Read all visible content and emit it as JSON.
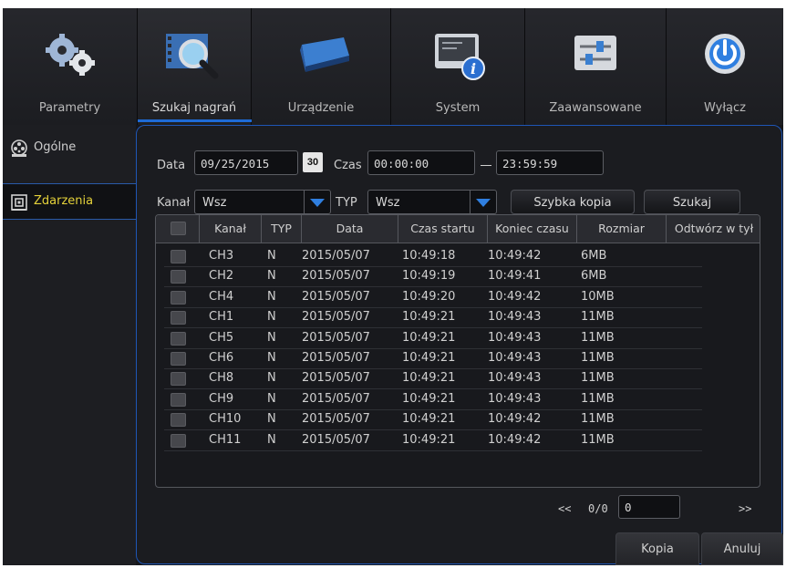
{
  "nav": {
    "items": [
      {
        "label": "Parametry"
      },
      {
        "label": "Szukaj nagrań"
      },
      {
        "label": "Urządzenie"
      },
      {
        "label": "System"
      },
      {
        "label": "Zaawansowane"
      },
      {
        "label": "Wyłącz"
      }
    ],
    "active_index": 1
  },
  "sidebar": {
    "items": [
      {
        "label": "Ogólne",
        "icon": "film-reel-icon"
      },
      {
        "label": "Zdarzenia",
        "icon": "event-film-icon"
      }
    ],
    "active_index": 1
  },
  "search": {
    "date_label": "Data",
    "date_value": "09/25/2015",
    "calendar_day": "30",
    "time_label": "Czas",
    "time_from": "00:00:00",
    "time_to": "23:59:59",
    "channel_label": "Kanał",
    "channel_value": "Wsz",
    "type_label": "TYP",
    "type_value": "Wsz",
    "quick_copy_label": "Szybka kopia",
    "search_label": "Szukaj"
  },
  "table": {
    "columns": [
      "Kanał",
      "TYP",
      "Data",
      "Czas startu",
      "Koniec czasu",
      "Rozmiar",
      "Odtwórz w tył"
    ],
    "rows": [
      {
        "channel": "CH3",
        "type": "N",
        "date": "2015/05/07",
        "start": "10:49:18",
        "end": "10:49:42",
        "size": "6MB"
      },
      {
        "channel": "CH2",
        "type": "N",
        "date": "2015/05/07",
        "start": "10:49:19",
        "end": "10:49:41",
        "size": "6MB"
      },
      {
        "channel": "CH4",
        "type": "N",
        "date": "2015/05/07",
        "start": "10:49:20",
        "end": "10:49:42",
        "size": "10MB"
      },
      {
        "channel": "CH1",
        "type": "N",
        "date": "2015/05/07",
        "start": "10:49:21",
        "end": "10:49:43",
        "size": "11MB"
      },
      {
        "channel": "CH5",
        "type": "N",
        "date": "2015/05/07",
        "start": "10:49:21",
        "end": "10:49:43",
        "size": "11MB"
      },
      {
        "channel": "CH6",
        "type": "N",
        "date": "2015/05/07",
        "start": "10:49:21",
        "end": "10:49:43",
        "size": "11MB"
      },
      {
        "channel": "CH8",
        "type": "N",
        "date": "2015/05/07",
        "start": "10:49:21",
        "end": "10:49:43",
        "size": "11MB"
      },
      {
        "channel": "CH9",
        "type": "N",
        "date": "2015/05/07",
        "start": "10:49:21",
        "end": "10:49:43",
        "size": "11MB"
      },
      {
        "channel": "CH10",
        "type": "N",
        "date": "2015/05/07",
        "start": "10:49:21",
        "end": "10:49:42",
        "size": "11MB"
      },
      {
        "channel": "CH11",
        "type": "N",
        "date": "2015/05/07",
        "start": "10:49:21",
        "end": "10:49:42",
        "size": "11MB"
      }
    ]
  },
  "pager": {
    "prev": "<<",
    "status": "0/0",
    "page_input": "0",
    "next": ">>"
  },
  "actions": {
    "copy_label": "Kopia",
    "cancel_label": "Anuluj"
  },
  "colors": {
    "accent": "#1e6bd6",
    "active_sidebar_text": "#e5d23a"
  }
}
